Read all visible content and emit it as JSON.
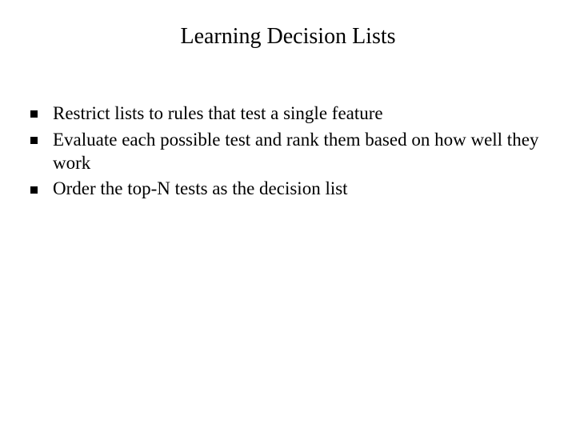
{
  "slide": {
    "title": "Learning Decision Lists",
    "bullets": [
      "Restrict lists to rules that test a single feature",
      "Evaluate each possible test and rank them based on how well they work",
      "Order the top-N tests as the decision list"
    ]
  }
}
